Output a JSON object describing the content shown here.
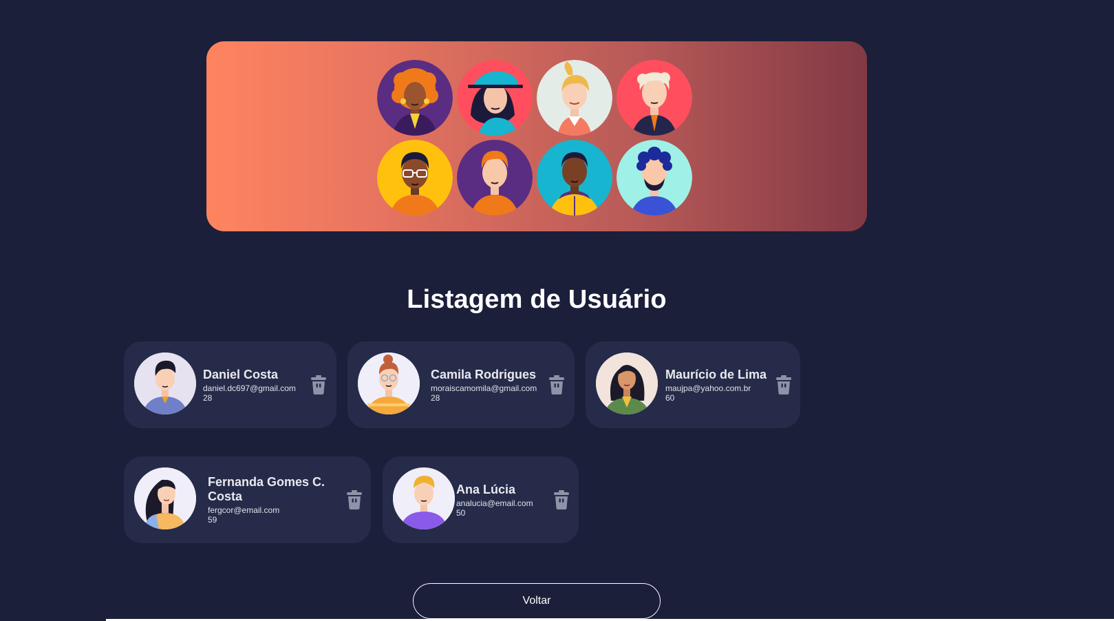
{
  "page": {
    "title": "Listagem de Usuário",
    "back_label": "Voltar"
  },
  "hero": {
    "avatars": [
      {
        "name": "avatar-woman-curly-orange-hair",
        "bg": "#5a2d82"
      },
      {
        "name": "avatar-woman-teal-cap",
        "bg": "#ff4f5e"
      },
      {
        "name": "avatar-woman-blonde-ponytail",
        "bg": "#e4ece8"
      },
      {
        "name": "avatar-man-white-hair",
        "bg": "#ff4f5e"
      },
      {
        "name": "avatar-man-glasses",
        "bg": "#ffc10e"
      },
      {
        "name": "avatar-man-red-hair",
        "bg": "#5a2d82"
      },
      {
        "name": "avatar-man-yellow-hoodie",
        "bg": "#17b5d0"
      },
      {
        "name": "avatar-man-curly-beard",
        "bg": "#9ff0e6"
      }
    ]
  },
  "users": [
    {
      "name": "Daniel Costa",
      "email": "daniel.dc697@gmail.com",
      "age": "28"
    },
    {
      "name": "Camila Rodrigues",
      "email": "moraiscamomila@gmail.com",
      "age": "28"
    },
    {
      "name": "Maurício de Lima",
      "email": "maujpa@yahoo.com.br",
      "age": "60"
    },
    {
      "name": "Fernanda Gomes C. Costa",
      "email": "fergcor@email.com",
      "age": "59"
    },
    {
      "name": "Ana Lúcia",
      "email": "analucia@email.com",
      "age": "50"
    }
  ],
  "colors": {
    "background": "#1b1f3a",
    "card": "#252b48",
    "hero_gradient_start": "#ff8460",
    "hero_gradient_end": "#823944",
    "trash_icon": "#8e93a8"
  }
}
